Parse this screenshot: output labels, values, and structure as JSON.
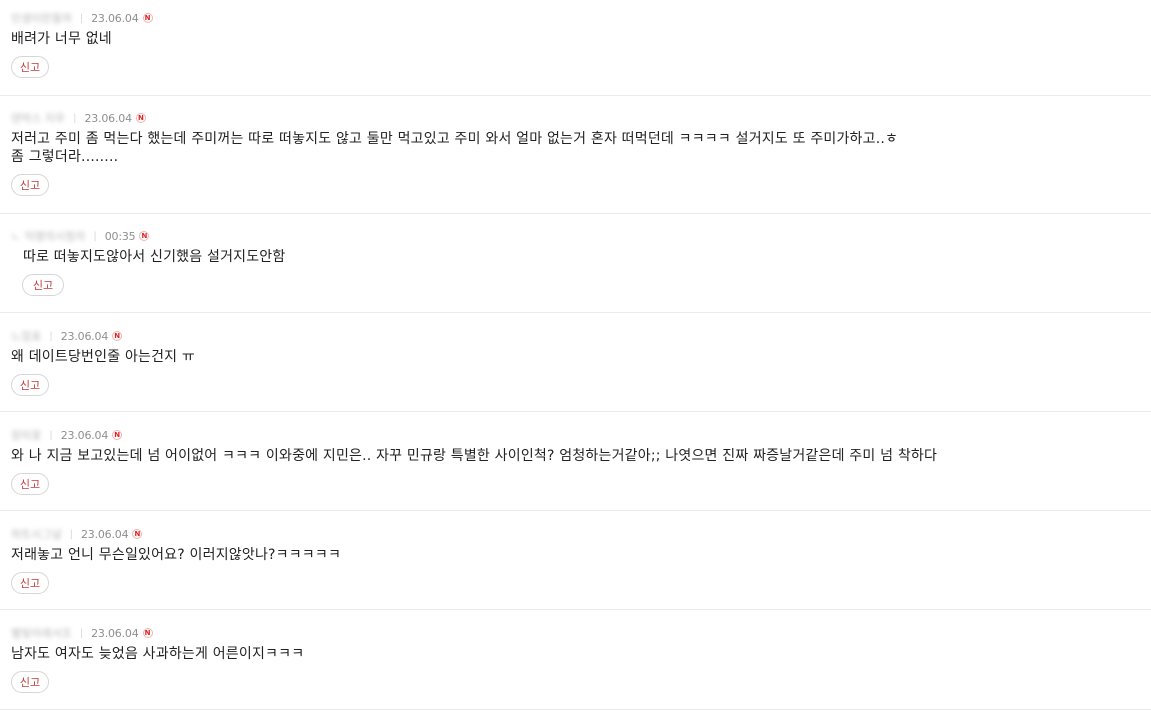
{
  "comments": [
    {
      "nick": "인생이란뭘까",
      "date": "23.06.04",
      "new_badge": "N",
      "text": "배려가 너무 없네",
      "report_label": "신고"
    },
    {
      "nick": "덴막스 지우",
      "date": "23.06.04",
      "new_badge": "N",
      "text": "저러고 주미 좀 먹는다 했는데 주미꺼는 따로 떠놓지도 않고 둘만 먹고있고 주미 와서 얼마 없는거 혼자 떠먹던데 ㅋㅋㅋㅋ 설거지도 또 주미가하고..ㅎ\n좀 그렇더라........",
      "report_label": "신고"
    },
    {
      "nick": "ㄴ 익명의시청자",
      "date": "00:35",
      "new_badge": "N",
      "text": "따로 떠놓지도않아서 신기했음 설거지도안함",
      "report_label": "신고"
    },
    {
      "nick": "느낌표",
      "date": "23.06.04",
      "new_badge": "N",
      "text": "왜 데이트당번인줄 아는건지 ㅠ",
      "report_label": "신고"
    },
    {
      "nick": "장미꽃",
      "date": "23.06.04",
      "new_badge": "N",
      "text": "와 나 지금 보고있는데 넘 어이없어 ㅋㅋㅋ 이와중에 지민은.. 자꾸 민규랑 특별한 사이인척? 엄청하는거같아;; 나엿으면 진짜 짜증날거같은데 주미 넘 착하다",
      "report_label": "신고"
    },
    {
      "nick": "하트시그널",
      "date": "23.06.04",
      "new_badge": "N",
      "text": "저래놓고 언니 무슨일있어요? 이러지않앗나?ㅋㅋㅋㅋㅋ",
      "report_label": "신고"
    },
    {
      "nick": "별빛아래서조",
      "date": "23.06.04",
      "new_badge": "N",
      "text": "남자도 여자도 늦었음 사과하는게 어른이지ㅋㅋㅋ",
      "report_label": "신고"
    }
  ]
}
